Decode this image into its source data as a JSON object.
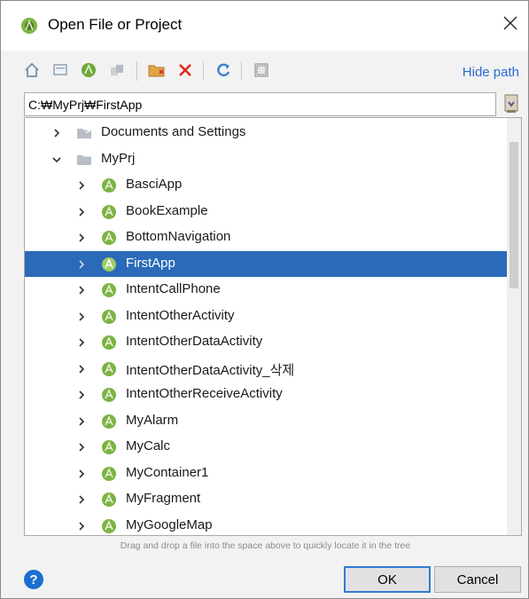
{
  "dialog": {
    "title": "Open File or Project"
  },
  "toolbar": {
    "hide_path_label": "Hide path",
    "buttons": [
      "home-icon",
      "desktop-icon",
      "project-icon",
      "module-icon",
      "new-folder-icon",
      "delete-icon",
      "refresh-icon",
      "show-hidden-icon"
    ]
  },
  "path": {
    "value": "C:₩MyPrj₩FirstApp"
  },
  "tree": {
    "items": [
      {
        "label": "Documents and Settings",
        "level": 1,
        "expanded": false,
        "icon": "folder-link-icon"
      },
      {
        "label": "MyPrj",
        "level": 1,
        "expanded": true,
        "icon": "folder-icon"
      },
      {
        "label": "BasciApp",
        "level": 2,
        "expanded": false,
        "icon": "android-project-icon"
      },
      {
        "label": "BookExample",
        "level": 2,
        "expanded": false,
        "icon": "android-project-icon"
      },
      {
        "label": "BottomNavigation",
        "level": 2,
        "expanded": false,
        "icon": "android-project-icon"
      },
      {
        "label": "FirstApp",
        "level": 2,
        "expanded": false,
        "icon": "android-project-icon",
        "selected": true
      },
      {
        "label": "IntentCallPhone",
        "level": 2,
        "expanded": false,
        "icon": "android-project-icon"
      },
      {
        "label": "IntentOtherActivity",
        "level": 2,
        "expanded": false,
        "icon": "android-project-icon"
      },
      {
        "label": "IntentOtherDataActivity",
        "level": 2,
        "expanded": false,
        "icon": "android-project-icon"
      },
      {
        "label": "IntentOtherDataActivity_삭제",
        "level": 2,
        "expanded": false,
        "icon": "android-project-icon"
      },
      {
        "label": "IntentOtherReceiveActivity",
        "level": 2,
        "expanded": false,
        "icon": "android-project-icon"
      },
      {
        "label": "MyAlarm",
        "level": 2,
        "expanded": false,
        "icon": "android-project-icon"
      },
      {
        "label": "MyCalc",
        "level": 2,
        "expanded": false,
        "icon": "android-project-icon"
      },
      {
        "label": "MyContainer1",
        "level": 2,
        "expanded": false,
        "icon": "android-project-icon"
      },
      {
        "label": "MyFragment",
        "level": 2,
        "expanded": false,
        "icon": "android-project-icon"
      },
      {
        "label": "MyGoogleMap",
        "level": 2,
        "expanded": false,
        "icon": "android-project-icon"
      }
    ]
  },
  "hint": "Drag and drop a file into the space above to quickly locate it in the tree",
  "buttons": {
    "help_label": "?",
    "ok_label": "OK",
    "cancel_label": "Cancel"
  },
  "colors": {
    "selection": "#2a6ab8",
    "link": "#2a6bd1",
    "android_green": "#7cb342"
  }
}
